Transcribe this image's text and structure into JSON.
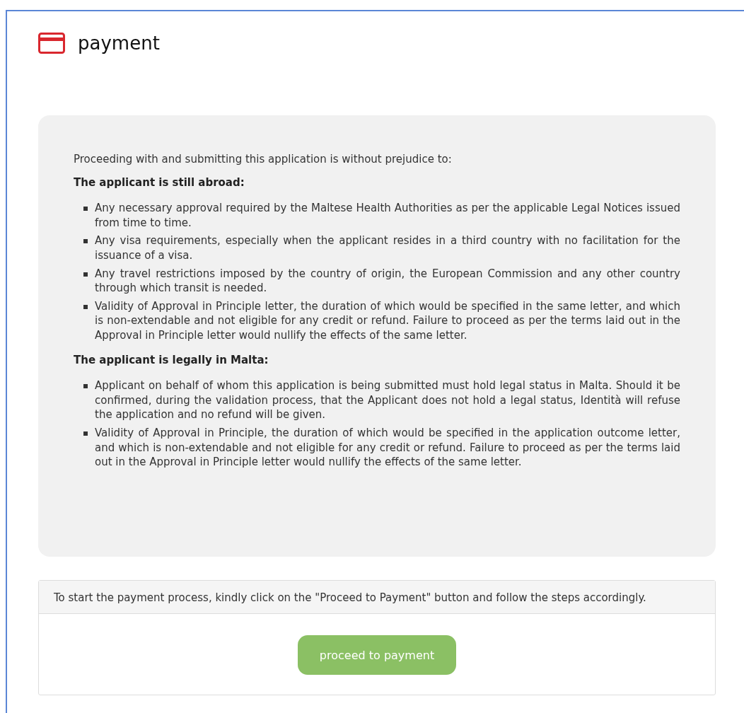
{
  "page": {
    "title": "payment"
  },
  "notice": {
    "intro": "Proceeding with and submitting this application is without prejudice to:",
    "sections": [
      {
        "heading": "The applicant is still abroad:",
        "items": [
          "Any necessary approval required by the Maltese Health Authorities as per the applicable Legal Notices issued from time to time.",
          "Any visa requirements, especially when the applicant resides in a third country with no facilitation for the issuance of a visa.",
          "Any travel restrictions imposed by the country of origin, the European Commission and any other country through which transit is needed.",
          "Validity of Approval in Principle letter, the duration of which would be specified in the same letter, and which is non-extendable and not eligible for any credit or refund. Failure to proceed as per the terms laid out in the Approval in Principle letter would nullify the effects of the same letter."
        ]
      },
      {
        "heading": "The applicant is legally in Malta:",
        "items": [
          "Applicant on behalf of whom this application is being submitted must hold legal status in Malta. Should it be confirmed, during the validation process, that the Applicant does not hold a legal status, Identità will refuse the application and no refund will be given.",
          "Validity of Approval in Principle, the duration of which would be specified in the application outcome letter, and which is non-extendable and not eligible for any credit or refund. Failure to proceed as per the terms laid out in the Approval in Principle letter would nullify the effects of the same letter."
        ]
      }
    ]
  },
  "payment_panel": {
    "instruction": "To start the payment process, kindly click on the \"Proceed to Payment\" button and follow the steps accordingly.",
    "button": "proceed to payment"
  }
}
